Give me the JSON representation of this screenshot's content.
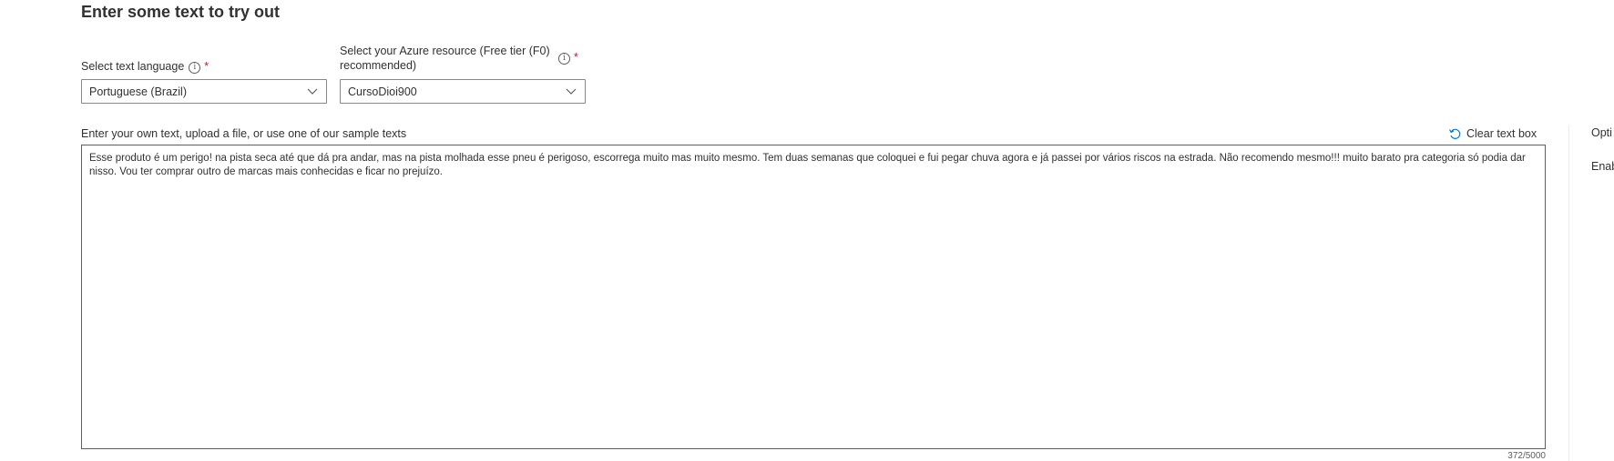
{
  "page": {
    "title": "Enter some text to try out"
  },
  "language_select": {
    "label": "Select text language",
    "required_mark": "*",
    "info_glyph": "i",
    "value": "Portuguese (Brazil)"
  },
  "resource_select": {
    "label_line1": "Select your Azure resource (Free tier (F0)",
    "label_line2": "recommended)",
    "required_mark": "*",
    "info_glyph": "i",
    "value": "CursoDioi900"
  },
  "text_input": {
    "label": "Enter your own text, upload a file, or use one of our sample texts",
    "clear_label": "Clear text box",
    "value": "Esse produto é um perigo! na pista seca até que dá pra andar, mas na pista molhada esse pneu é perigoso, escorrega muito mas muito mesmo. Tem duas semanas que coloquei e fui pegar chuva agora e já passei por vários riscos na estrada. Não recomendo mesmo!!! muito barato pra categoria só podia dar nisso. Vou ter comprar outro de marcas mais conhecidas e ficar no prejuízo.",
    "char_count": "372/5000"
  },
  "side_panel": {
    "heading_partial": "Opti",
    "option_partial": "Enab"
  },
  "icons": {
    "info": "info-icon",
    "chevron": "chevron-down-icon",
    "clear": "undo-icon"
  },
  "colors": {
    "accent": "#0078d4",
    "required": "#a4262c",
    "border": "#8a8886"
  }
}
